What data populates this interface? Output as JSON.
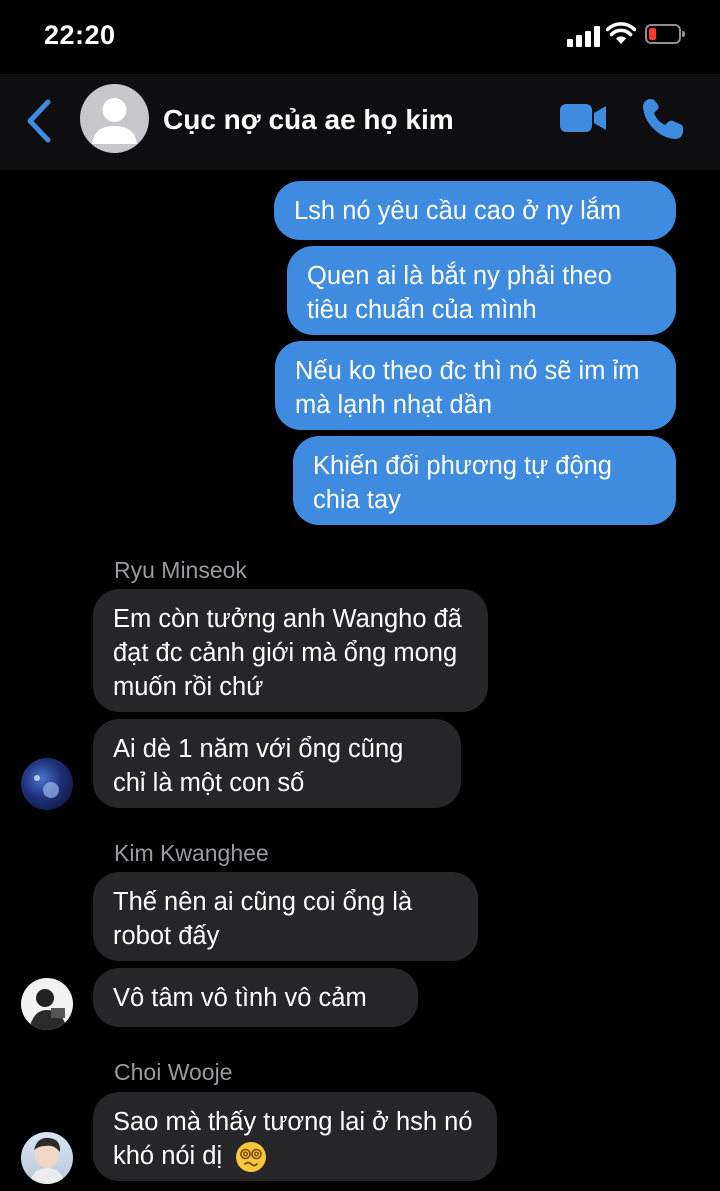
{
  "status_bar": {
    "time": "22:20"
  },
  "header": {
    "title": "Cục nợ của ae họ kim"
  },
  "messages": {
    "sent": [
      "Lsh nó yêu cầu cao ở ny lắm",
      "Quen ai là bắt ny phải theo tiêu chuẩn của mình",
      "Nếu ko theo đc thì nó sẽ im ỉm mà lạnh nhạt dần",
      "Khiến đối phương tự động chia tay"
    ],
    "groups": [
      {
        "sender": "Ryu Minseok",
        "bubbles": [
          "Em còn tưởng anh Wangho đã đạt đc cảnh giới mà ổng mong muốn rồi chứ",
          "Ai dè 1 năm với ổng cũng chỉ là một con số"
        ]
      },
      {
        "sender": "Kim Kwanghee",
        "bubbles": [
          "Thế nên ai cũng coi ổng là robot đấy",
          "Vô tâm vô tình vô cảm"
        ]
      },
      {
        "sender": "Choi Wooje",
        "bubbles": [
          "Sao mà thấy tương lai ở hsh nó khó nói dị"
        ]
      }
    ]
  },
  "icons": {
    "back": "chevron-left-icon",
    "video": "video-camera-icon",
    "phone": "phone-icon",
    "emoji": "dizzy-face-emoji"
  },
  "colors": {
    "accent": "#3f8be0",
    "received_bubble": "#262628",
    "sender_name": "#9a9a9f",
    "header_bg": "#0e0e10"
  }
}
